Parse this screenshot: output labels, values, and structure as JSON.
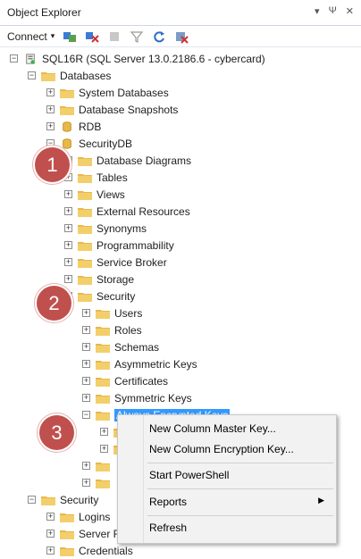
{
  "window": {
    "title": "Object Explorer",
    "buttons": [
      "▾",
      "Ψ",
      "✕"
    ]
  },
  "toolbar": {
    "connect_label": "Connect",
    "connect_arrow": "▾"
  },
  "tree": {
    "server": "SQL16R (SQL Server 13.0.2186.6 - cybercard)",
    "databases": "Databases",
    "system_databases": "System Databases",
    "snapshots": "Database Snapshots",
    "rdb": "RDB",
    "securitydb": "SecurityDB",
    "db_diagrams": "Database Diagrams",
    "tables": "Tables",
    "views": "Views",
    "external_resources": "External Resources",
    "synonyms": "Synonyms",
    "programmability": "Programmability",
    "service_broker": "Service Broker",
    "storage": "Storage",
    "security": "Security",
    "users": "Users",
    "roles": "Roles",
    "schemas": "Schemas",
    "asymmetric_keys": "Asymmetric Keys",
    "certificates": "Certificates",
    "symmetric_keys": "Symmetric Keys",
    "always_encrypted_keys": "Always Encrypted Keys",
    "server_security": "Security",
    "logins": "Logins",
    "server_roles": "Server R",
    "credentials": "Credentials"
  },
  "badges": [
    "1",
    "2",
    "3"
  ],
  "context_menu": {
    "new_cmk": "New Column Master Key...",
    "new_cek": "New Column Encryption Key...",
    "start_powershell": "Start PowerShell",
    "reports": "Reports",
    "refresh": "Refresh",
    "submenu_arrow": "▶"
  },
  "colors": {
    "badge": "#c0504d",
    "selection": "#3399ff",
    "folder": "#e8b84a"
  }
}
